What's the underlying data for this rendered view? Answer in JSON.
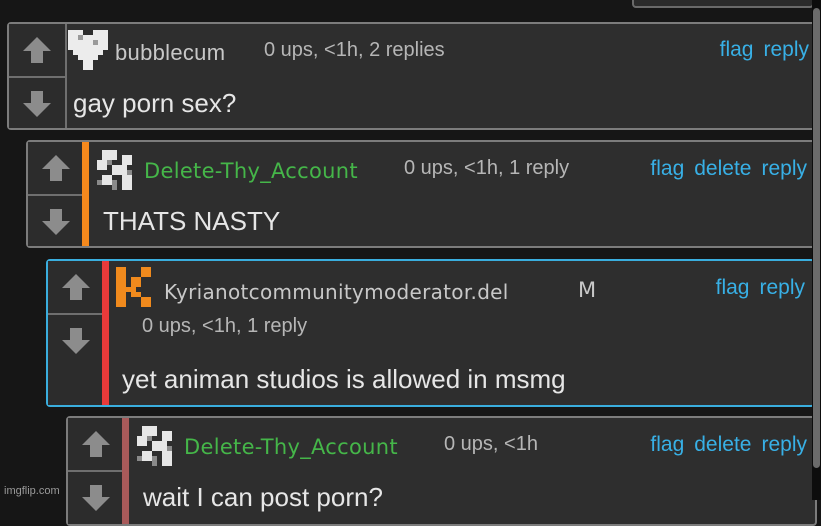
{
  "comments": [
    {
      "username": "bubblecum",
      "meta": "0 ups, <1h, 2 replies",
      "body": "gay porn sex?",
      "actions": [
        "flag",
        "reply"
      ],
      "accent_color": ""
    },
    {
      "username": "Delete-Thy_Account",
      "meta": "0 ups, <1h, 1 reply",
      "body": "THATS NASTY",
      "actions": [
        "flag",
        "delete",
        "reply"
      ],
      "accent_color": "#f5891d"
    },
    {
      "username": "Kyrianotcommunitymoderator.del",
      "badge": "M",
      "meta": "0 ups, <1h, 1 reply",
      "body": "yet animan studios is allowed in msmg",
      "actions": [
        "flag",
        "reply"
      ],
      "accent_color": "#e83a3a"
    },
    {
      "username": "Delete-Thy_Account",
      "meta": "0 ups, <1h",
      "body": "wait I can post porn?",
      "actions": [
        "flag",
        "delete",
        "reply"
      ],
      "accent_color": "#a85a5a"
    }
  ],
  "icons": {
    "upvote": "arrow-up-icon",
    "downvote": "arrow-down-icon"
  },
  "colors": {
    "link": "#38b0e6",
    "username_green": "#45b649",
    "active_border": "#3aaede"
  },
  "watermark": "imgflip.com"
}
